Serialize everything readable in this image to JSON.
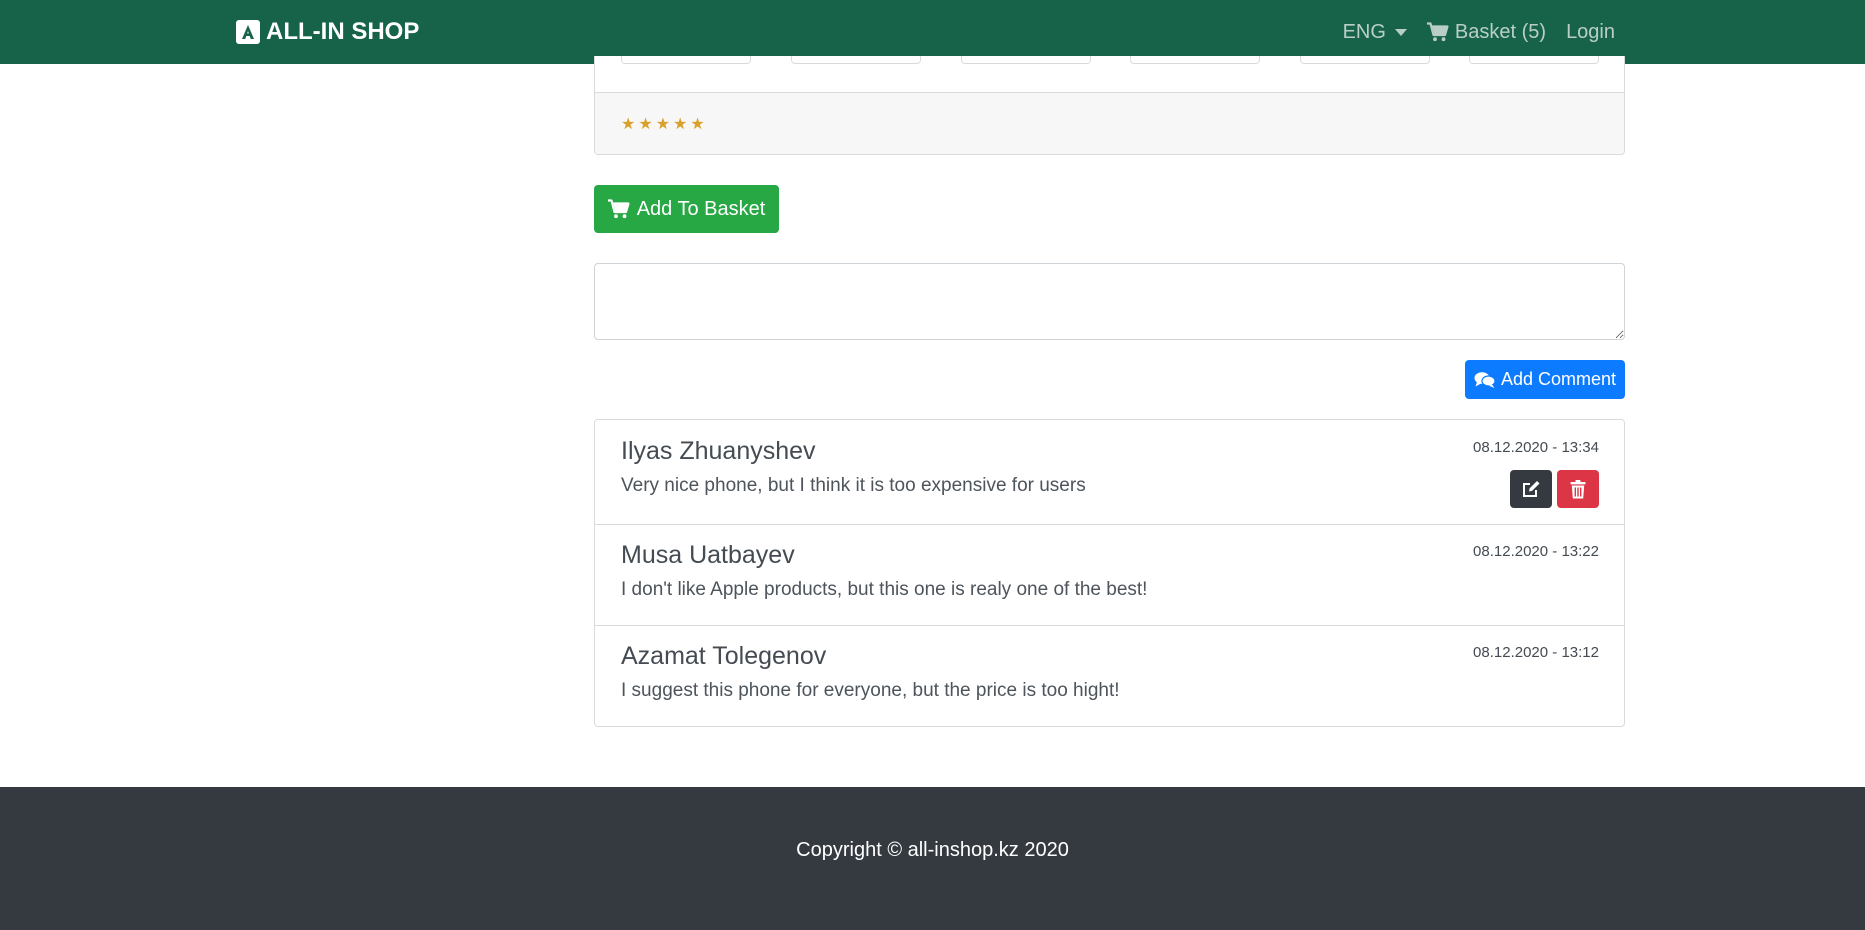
{
  "navbar": {
    "brand": "ALL-IN SHOP",
    "language": "ENG",
    "basket_label": "Basket (5)",
    "login_label": "Login",
    "background": "#176349"
  },
  "product": {
    "rating_stars": "★★★★★",
    "rating_value": 5,
    "add_to_basket_label": "Add To Basket"
  },
  "comment_form": {
    "textarea_value": "",
    "add_comment_label": "Add Comment"
  },
  "comments": [
    {
      "author": "Ilyas Zhuanyshev",
      "date": "08.12.2020 - 13:34",
      "text": "Very nice phone, but I think it is too expensive for users",
      "actions": [
        "edit-icon",
        "trash-icon"
      ]
    },
    {
      "author": "Musa Uatbayev",
      "date": "08.12.2020 - 13:22",
      "text": "I don't like Apple products, but this one is realy one of the best!"
    },
    {
      "author": "Azamat Tolegenov",
      "date": "08.12.2020 - 13:12",
      "text": "I suggest this phone for everyone, but the price is too hight!"
    }
  ],
  "footer": {
    "copyright": "Copyright © all-inshop.kz 2020"
  },
  "colors": {
    "success": "#28a745",
    "primary": "#0d7bff",
    "danger": "#dc3545",
    "dark": "#343a40",
    "star": "#d9a12b"
  }
}
